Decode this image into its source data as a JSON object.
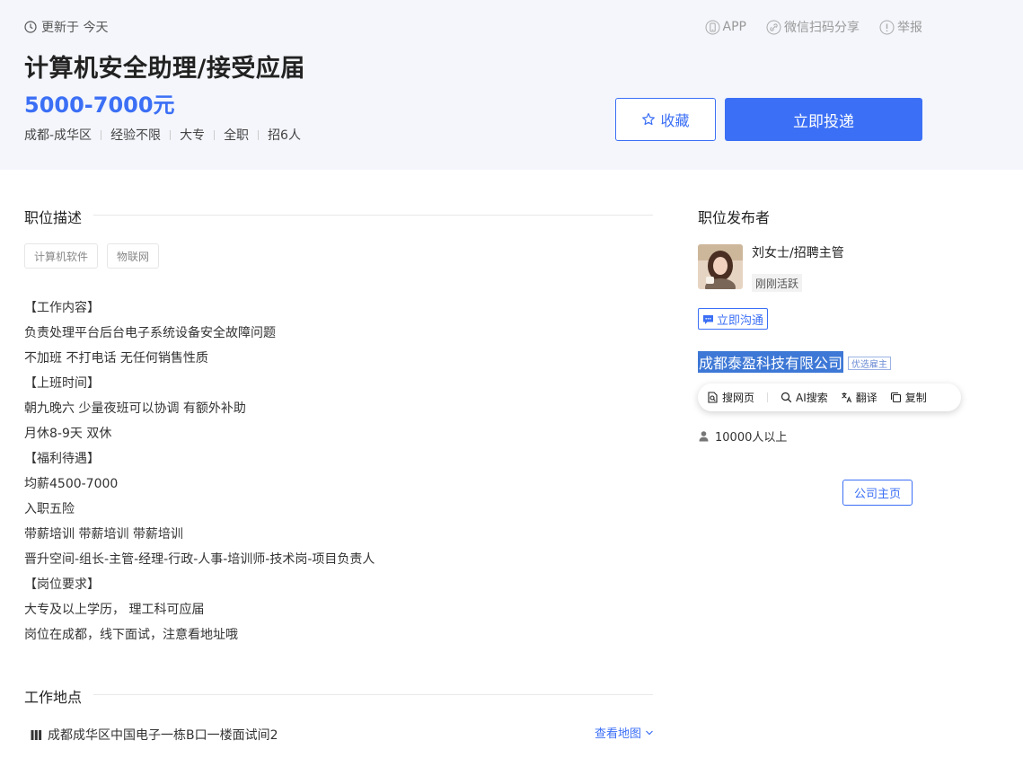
{
  "header": {
    "updated_label": "更新于 今天",
    "job_title": "计算机安全助理/接受应届",
    "salary": "5000-7000元",
    "meta": [
      "成都-成华区",
      "经验不限",
      "大专",
      "全职",
      "招6人"
    ],
    "actions": [
      {
        "label": "APP",
        "icon": "phone-icon"
      },
      {
        "label": "微信扫码分享",
        "icon": "share-icon"
      },
      {
        "label": "举报",
        "icon": "report-icon"
      }
    ],
    "favorite_label": "收藏",
    "apply_label": "立即投递"
  },
  "description": {
    "title": "职位描述",
    "tags": [
      "计算机软件",
      "物联网"
    ],
    "lines": [
      "【工作内容】",
      "负责处理平台后台电子系统设备安全故障问题",
      "不加班 不打电话 无任何销售性质",
      "【上班时间】",
      "朝九晚六 少量夜班可以协调 有额外补助",
      "月休8-9天 双休",
      "【福利待遇】",
      "均薪4500-7000",
      "入职五险",
      "带薪培训 带薪培训 带薪培训",
      "晋升空间-组长-主管-经理-行政-人事-培训师-技术岗-项目负责人",
      "【岗位要求】",
      "大专及以上学历， 理工科可应届",
      "岗位在成都，线下面试，注意看地址哦"
    ]
  },
  "location": {
    "title": "工作地点",
    "address": "成都成华区中国电子一栋B口一楼面试间2",
    "map_label": "查看地图"
  },
  "publisher": {
    "title": "职位发布者",
    "name": "刘女士/招聘主管",
    "status": "刚刚活跃",
    "chat_label": "立即沟通"
  },
  "company": {
    "name": "成都泰盈科技有限公司",
    "badge": "优选雇主",
    "size": "10000人以上",
    "home_label": "公司主页"
  },
  "popup": {
    "items": [
      "搜网页",
      "AI搜索",
      "翻译",
      "复制"
    ]
  },
  "colors": {
    "accent": "#3b6ff5",
    "header_bg": "#f4f6fb",
    "selection": "#3e78d6"
  }
}
